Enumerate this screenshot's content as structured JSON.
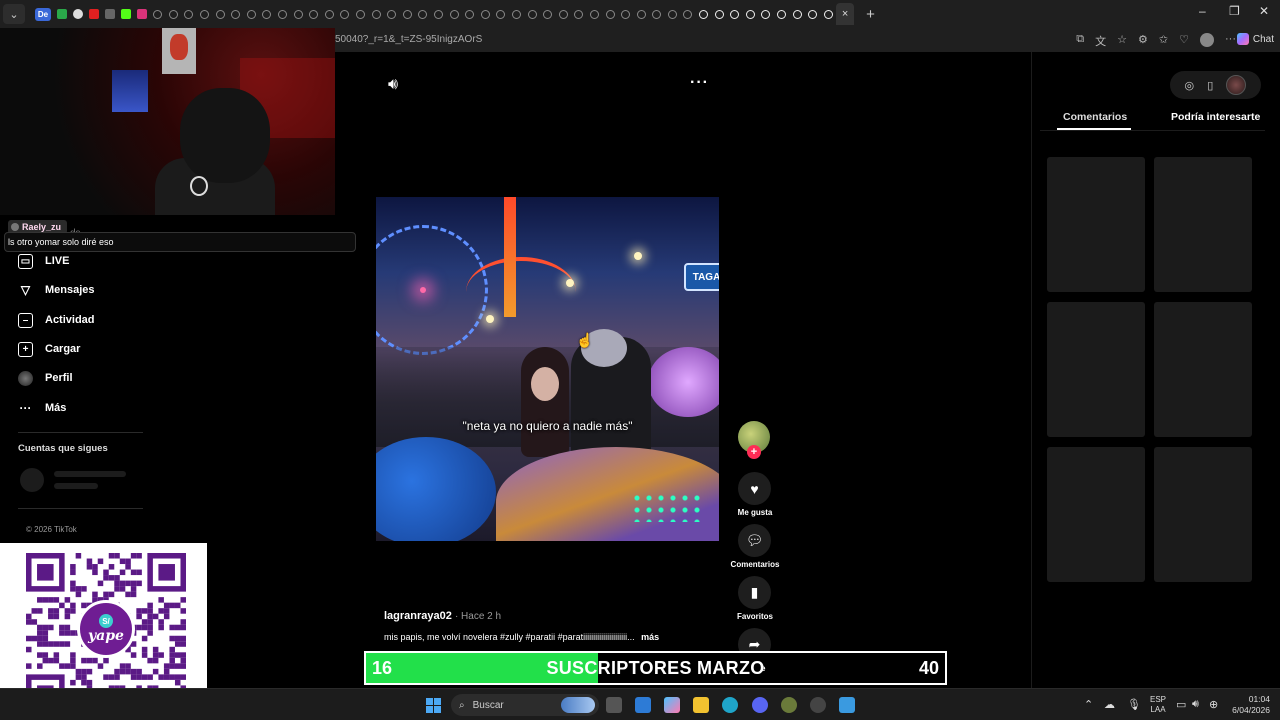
{
  "browser": {
    "workspace_label": "De",
    "url": "50040?_r=1&_t=ZS-95InigzAOrS",
    "chat_label": "Chat",
    "new_tab": "+",
    "close_tab": "×"
  },
  "overlay": {
    "chat_username": "Raely_zu",
    "chat_message": "ls otro yomar solo diré eso",
    "hidden_nav_text": "ds"
  },
  "sidebar": {
    "items": [
      {
        "label": "LIVE",
        "icon": "live-tv-icon"
      },
      {
        "label": "Mensajes",
        "icon": "send-icon"
      },
      {
        "label": "Actividad",
        "icon": "activity-icon"
      },
      {
        "label": "Cargar",
        "icon": "upload-plus-icon"
      },
      {
        "label": "Perfil",
        "icon": "profile-avatar"
      },
      {
        "label": "Más",
        "icon": "more-dots-icon"
      }
    ],
    "following_title": "Cuentas que sigues",
    "copyright": "© 2026 TikTok"
  },
  "qr": {
    "brand": "yape",
    "coin": "S/"
  },
  "video": {
    "subtitle": "\"neta ya no quiero a nadie más\"",
    "sign_text": "TAGA",
    "author": "lagranraya02",
    "time": "· Hace 2 h",
    "description": "mis papis, me volví novelera #zully #paratii #paratiiiiiiiiiiiiiiiiiiiiii...",
    "more": "más"
  },
  "actions": {
    "like": "Me gusta",
    "comments": "Comentarios",
    "favorites": "Favoritos",
    "share_partial": "e"
  },
  "subscriber_bar": {
    "current": "16",
    "title": "SUSCRIPTORES MARZO",
    "goal": "40",
    "progress": 0.4,
    "fill_color": "#22e04a"
  },
  "right_panel": {
    "tab_comments": "Comentarios",
    "tab_interest": "Podría interesarte"
  },
  "taskbar": {
    "search_placeholder": "Buscar",
    "lang_top": "ESP",
    "lang_bottom": "LAA",
    "time": "01:04",
    "date": "6/04/2026"
  }
}
